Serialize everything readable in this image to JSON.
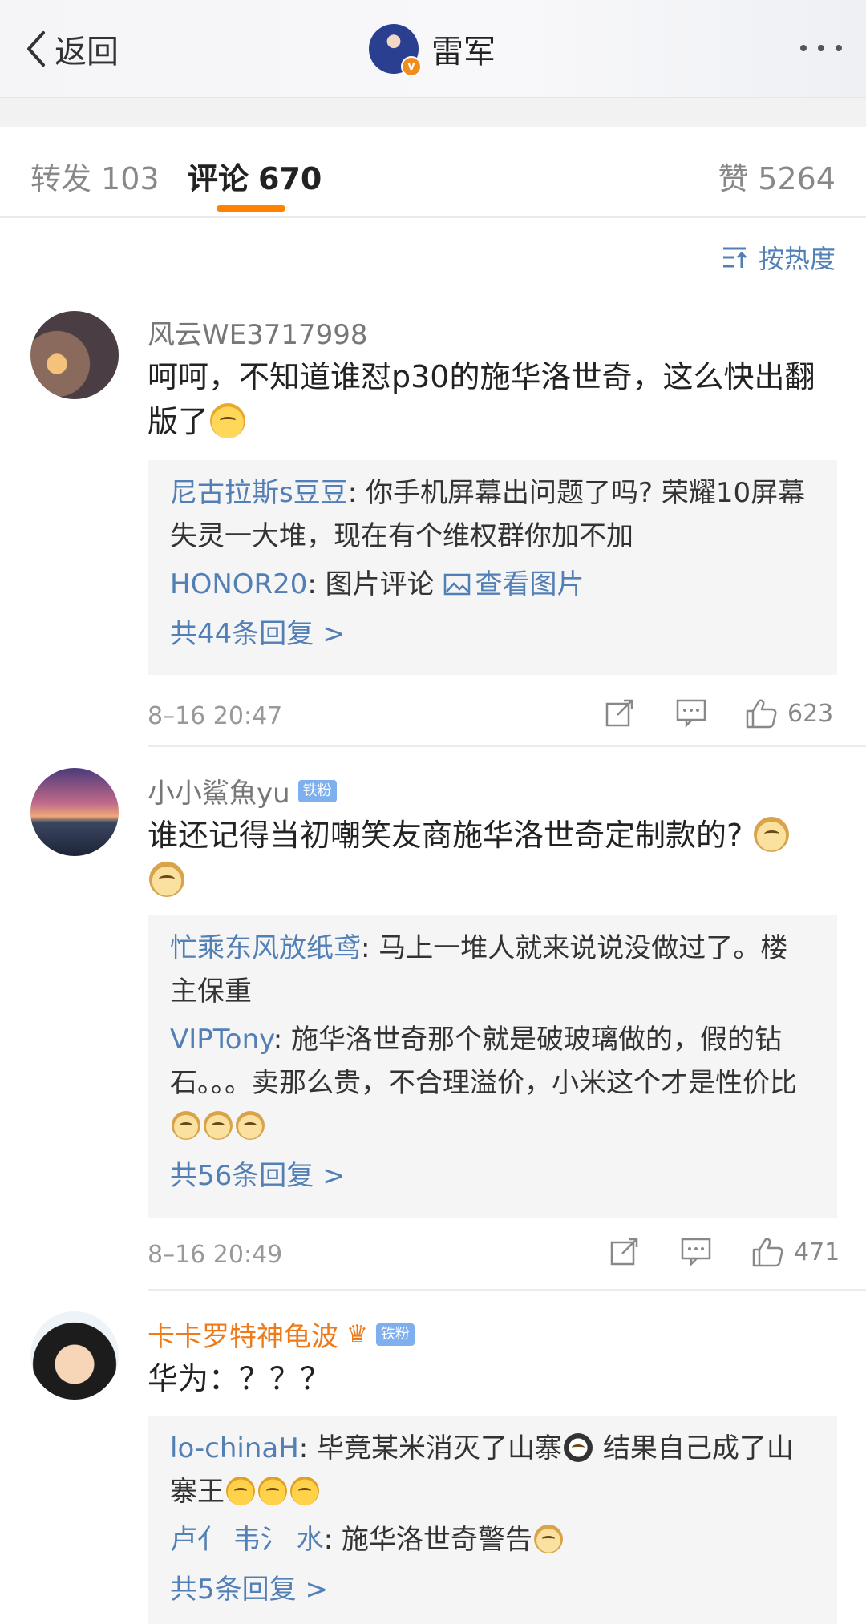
{
  "header": {
    "back_label": "返回",
    "title": "雷军",
    "verified_badge": "v"
  },
  "tabs": {
    "forward_label": "转发",
    "forward_count": "103",
    "comment_label": "评论",
    "comment_count": "670",
    "like_label": "赞",
    "like_count": "5264"
  },
  "sort_label": "按热度",
  "colors": {
    "accent": "#ff8200",
    "link": "#527fb5",
    "orange_name": "#ef7a1a",
    "fan_badge": "#7fb0ee"
  },
  "comments": [
    {
      "username": "风云WE3717998",
      "text": "呵呵，不知道谁怼p30的施华洛世奇，这么快出翻版了",
      "emoji": "shush-emoji",
      "replies": [
        {
          "user": "尼古拉斯s豆豆",
          "text": ": 你手机屏幕出问题了吗? 荣耀10屏幕失灵一大堆，现在有个维权群你加不加"
        },
        {
          "user": "HONOR20",
          "text": ": 图片评论 ",
          "link": "查看图片"
        }
      ],
      "more_replies": "共44条回复 >",
      "time": "8–16 20:47",
      "likes": "623"
    },
    {
      "username": "小小鯊魚yu",
      "badge": "铁粉",
      "text": "谁还记得当初嘲笑友商施华洛世奇定制款的?",
      "replies": [
        {
          "user": "忙乘东风放纸鸢",
          "text": ": 马上一堆人就来说说没做过了。楼主保重"
        },
        {
          "user": "VIPTony",
          "text": ": 施华洛世奇那个就是破玻璃做的，假的钻石。。。卖那么贵，不合理溢价，小米这个才是性价比"
        }
      ],
      "more_replies": "共56条回复 >",
      "time": "8–16 20:49",
      "likes": "471"
    },
    {
      "username": "卡卡罗特神龟波",
      "badge": "铁粉",
      "text": "华为：？？？",
      "replies": [
        {
          "user": "lo-chinaH",
          "text": ": 毕竟某米消灭了山寨",
          "text2": " 结果自己成了山寨王"
        },
        {
          "user": "卢亻 韦氵 水",
          "text": ": 施华洛世奇警告"
        }
      ],
      "more_replies": "共5条回复 >"
    }
  ]
}
